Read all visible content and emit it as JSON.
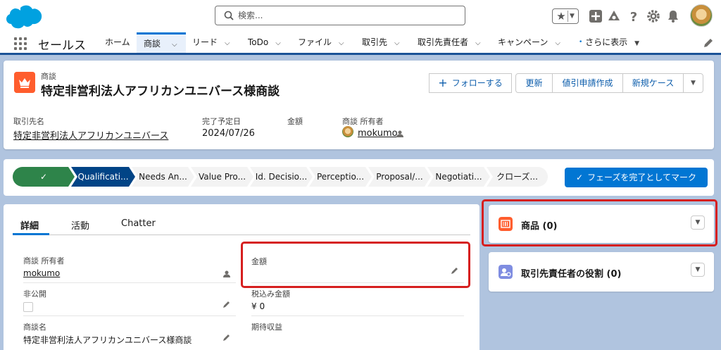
{
  "header": {
    "search_placeholder": "検索...",
    "brand_color": "#00a1e0"
  },
  "nav": {
    "app_name": "セールス",
    "items": [
      {
        "label": "ホーム"
      },
      {
        "label": "商談"
      },
      {
        "label": "リード"
      },
      {
        "label": "ToDo"
      },
      {
        "label": "ファイル"
      },
      {
        "label": "取引先"
      },
      {
        "label": "取引先責任者"
      },
      {
        "label": "キャンペーン"
      },
      {
        "label": "さらに表示"
      }
    ]
  },
  "record": {
    "object_label": "商談",
    "name": "特定非営利法人アフリカンユニバース様商談",
    "buttons": {
      "follow": "フォローする",
      "refresh": "更新",
      "discount": "値引申請作成",
      "new_case": "新規ケース"
    },
    "highlight_fields": [
      {
        "label": "取引先名",
        "value": "特定非営利法人アフリカンユニバース"
      },
      {
        "label": "完了予定日",
        "value": "2024/07/26"
      },
      {
        "label": "金額",
        "value": ""
      },
      {
        "label": "商談 所有者",
        "value": "mokumo"
      }
    ]
  },
  "path": {
    "stages": [
      {
        "label": "✓",
        "state": "done"
      },
      {
        "label": "Qualificati...",
        "state": "current"
      },
      {
        "label": "Needs An...",
        "state": "todo"
      },
      {
        "label": "Value Pro...",
        "state": "todo"
      },
      {
        "label": "Id. Decisio...",
        "state": "todo"
      },
      {
        "label": "Perceptio...",
        "state": "todo"
      },
      {
        "label": "Proposal/...",
        "state": "todo"
      },
      {
        "label": "Negotiati...",
        "state": "todo"
      },
      {
        "label": "クローズ...",
        "state": "todo"
      }
    ],
    "mark_complete": "フェーズを完了としてマーク"
  },
  "tabs": [
    {
      "label": "詳細"
    },
    {
      "label": "活動"
    },
    {
      "label": "Chatter"
    }
  ],
  "detail": {
    "owner_label": "商談 所有者",
    "owner_value": "mokumo",
    "private_label": "非公開",
    "opp_name_label": "商談名",
    "opp_name_value": "特定非営利法人アフリカンユニバース様商談",
    "amount_label": "金額",
    "amount_value": "",
    "tax_amount_label": "税込み金額",
    "tax_amount_value": "¥ 0",
    "expected_revenue_label": "期待収益"
  },
  "related": {
    "products": "商品 (0)",
    "contact_roles": "取引先責任者の役割 (0)"
  },
  "colors": {
    "accent": "#0176d3",
    "path_done": "#2e844a",
    "path_current": "#014486",
    "highlight_red": "#d61f1f",
    "opportunity_icon": "#ff5d2d",
    "products_icon": "#ff5d2d",
    "contact_roles_icon": "#7f8de1"
  },
  "icons": [
    "salesforce-cloud-icon",
    "search-icon",
    "star-icon",
    "plus-icon",
    "trailhead-icon",
    "help-icon",
    "gear-icon",
    "bell-icon",
    "waffle-icon",
    "edit-pencil-icon",
    "crown-icon",
    "check-icon",
    "owner-change-icon",
    "barcode-icon",
    "contact-role-icon",
    "chevron-down-icon"
  ]
}
